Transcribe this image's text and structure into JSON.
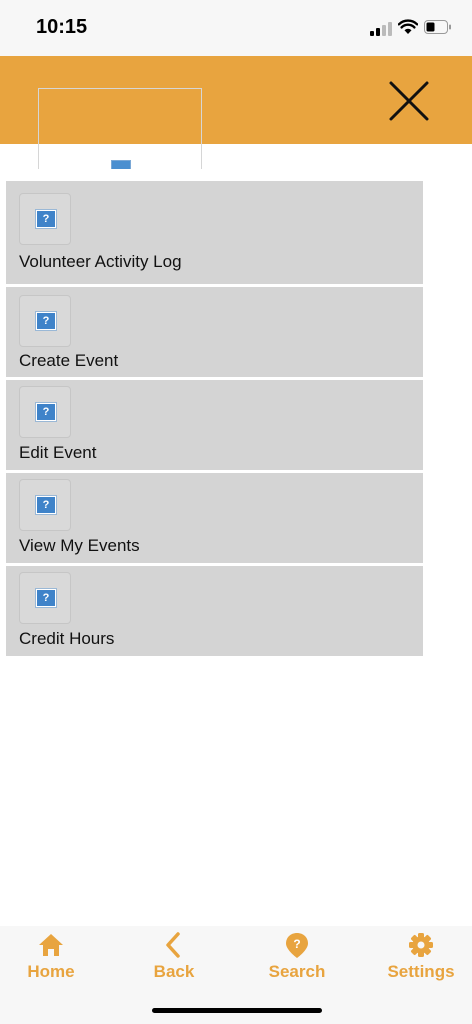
{
  "status_bar": {
    "time": "10:15"
  },
  "header": {
    "close_icon": "close-icon",
    "logo_icon": "broken-image-icon"
  },
  "menu": {
    "items": [
      {
        "label": "Volunteer Activity Log",
        "icon": "broken-image-icon"
      },
      {
        "label": "Create Event",
        "icon": "broken-image-icon"
      },
      {
        "label": "Edit Event",
        "icon": "broken-image-icon"
      },
      {
        "label": "View My Events",
        "icon": "broken-image-icon"
      },
      {
        "label": "Credit Hours",
        "icon": "broken-image-icon"
      }
    ]
  },
  "tab_bar": {
    "tabs": [
      {
        "label": "Home",
        "icon": "home-icon"
      },
      {
        "label": "Back",
        "icon": "chevron-left-icon"
      },
      {
        "label": "Search",
        "icon": "location-help-icon"
      },
      {
        "label": "Settings",
        "icon": "gear-icon"
      }
    ]
  },
  "colors": {
    "accent": "#e8a43f",
    "menu_bg": "#d4d4d4",
    "bar_bg": "#f7f7f7"
  }
}
